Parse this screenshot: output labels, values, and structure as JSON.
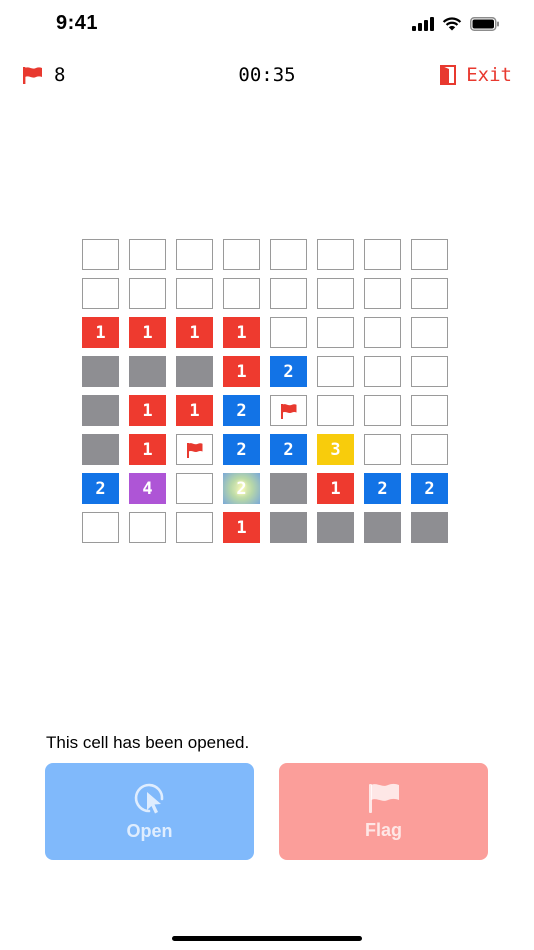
{
  "status_bar": {
    "time": "9:41"
  },
  "top_bar": {
    "flag_count": "8",
    "timer": "00:35",
    "exit_label": "Exit",
    "accent_color": "#e8392f"
  },
  "board": {
    "rows": 8,
    "cols": 8,
    "cells": [
      [
        {
          "s": "closed"
        },
        {
          "s": "closed"
        },
        {
          "s": "closed"
        },
        {
          "s": "closed"
        },
        {
          "s": "closed"
        },
        {
          "s": "closed"
        },
        {
          "s": "closed"
        },
        {
          "s": "closed"
        }
      ],
      [
        {
          "s": "closed"
        },
        {
          "s": "closed"
        },
        {
          "s": "closed"
        },
        {
          "s": "closed"
        },
        {
          "s": "closed"
        },
        {
          "s": "closed"
        },
        {
          "s": "closed"
        },
        {
          "s": "closed"
        }
      ],
      [
        {
          "s": "red",
          "v": "1"
        },
        {
          "s": "red",
          "v": "1"
        },
        {
          "s": "red",
          "v": "1"
        },
        {
          "s": "red",
          "v": "1"
        },
        {
          "s": "closed"
        },
        {
          "s": "closed"
        },
        {
          "s": "closed"
        },
        {
          "s": "closed"
        }
      ],
      [
        {
          "s": "gray"
        },
        {
          "s": "gray"
        },
        {
          "s": "gray"
        },
        {
          "s": "red",
          "v": "1"
        },
        {
          "s": "blue",
          "v": "2"
        },
        {
          "s": "closed"
        },
        {
          "s": "closed"
        },
        {
          "s": "closed"
        }
      ],
      [
        {
          "s": "gray"
        },
        {
          "s": "red",
          "v": "1"
        },
        {
          "s": "red",
          "v": "1"
        },
        {
          "s": "blue",
          "v": "2"
        },
        {
          "s": "flag"
        },
        {
          "s": "closed"
        },
        {
          "s": "closed"
        },
        {
          "s": "closed"
        }
      ],
      [
        {
          "s": "gray"
        },
        {
          "s": "red",
          "v": "1"
        },
        {
          "s": "flag"
        },
        {
          "s": "blue",
          "v": "2"
        },
        {
          "s": "blue",
          "v": "2"
        },
        {
          "s": "yellow",
          "v": "3"
        },
        {
          "s": "closed"
        },
        {
          "s": "closed"
        }
      ],
      [
        {
          "s": "blue",
          "v": "2"
        },
        {
          "s": "purple",
          "v": "4"
        },
        {
          "s": "closed"
        },
        {
          "s": "selected",
          "v": "2"
        },
        {
          "s": "gray"
        },
        {
          "s": "red",
          "v": "1"
        },
        {
          "s": "blue",
          "v": "2"
        },
        {
          "s": "blue",
          "v": "2"
        }
      ],
      [
        {
          "s": "closed"
        },
        {
          "s": "closed"
        },
        {
          "s": "closed"
        },
        {
          "s": "red",
          "v": "1"
        },
        {
          "s": "gray"
        },
        {
          "s": "gray"
        },
        {
          "s": "gray"
        },
        {
          "s": "gray"
        }
      ]
    ]
  },
  "message": "This cell has been opened.",
  "actions": {
    "open_label": "Open",
    "flag_label": "Flag"
  }
}
